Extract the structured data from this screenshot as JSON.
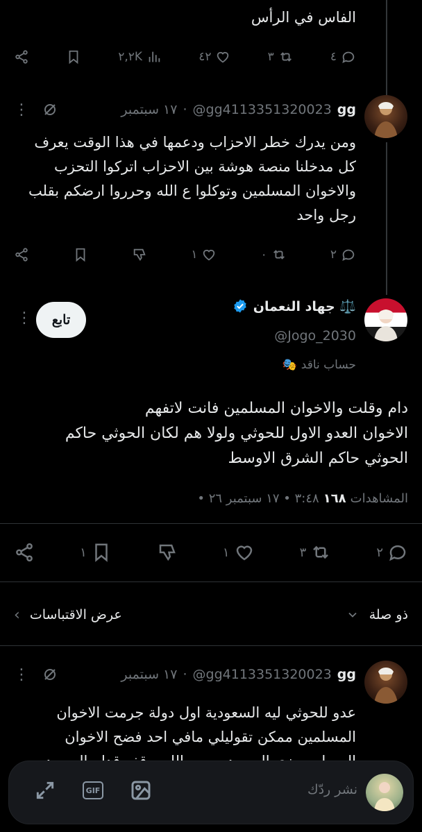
{
  "top_tweet": {
    "text_last_line": "الفاس في الرأس",
    "actions": {
      "replies": "٤",
      "retweets": "٣",
      "likes": "٤٢",
      "views": "٢,٢K"
    }
  },
  "reply1": {
    "name": "gg",
    "handle": "@gg4113351320023",
    "date": "١٧ سبتمبر",
    "sep": "·",
    "lines": [
      "ومن يدرك خطر الاحزاب ودعمها في هذا الوقت يعرف",
      "كل مدخلنا منصة هوشة بين الاحزاب اتركوا التحزب",
      "والاخوان المسلمين وتوكلوا ع الله وحرروا ارضكم بقلب",
      "رجل واحد"
    ],
    "actions": {
      "replies": "٢",
      "retweets": "٠",
      "likes": "١"
    }
  },
  "main_tweet": {
    "name": "جهاد النعمان ⚖️",
    "handle": "@Jogo_2030",
    "follow_label": "تابع",
    "label_icon": "🎭",
    "label_text": "حساب ناقد",
    "lines": [
      "دام وقلت والاخوان المسلمين فانت لاتفهم",
      "الاخوان العدو الاول للحوثي ولولا هم لكان الحوثي حاكم",
      "الحوثي حاكم الشرق الاوسط"
    ],
    "timestamp": "٣:٤٨ • ١٧ سبتمبر ٢٦ •",
    "views_count": "١٦٨",
    "views_label": "المشاهدات",
    "actions": {
      "replies": "٢",
      "retweets": "٣",
      "likes": "١",
      "bookmarks": "١"
    }
  },
  "relevant": {
    "left_label": "عرض الاقتباسات",
    "right_label": "ذو صلة"
  },
  "reply2": {
    "name": "gg",
    "handle": "@gg4113351320023",
    "date": "١٧ سبتمبر",
    "sep": "·",
    "lines": [
      "عدو للحوثي ليه السعودية اول دولة جرمت الاخوان",
      "المسلمين ممكن تقوليلي مافي احد فضح الاخوان",
      "المسلمين زي السعودين من اللي وقف قدام السعودين"
    ]
  },
  "composer": {
    "placeholder": "نشر ردّك",
    "gif_label": "GIF"
  },
  "colors": {
    "accent": "#1d9bf0",
    "muted": "#71767b",
    "background": "#000000"
  }
}
